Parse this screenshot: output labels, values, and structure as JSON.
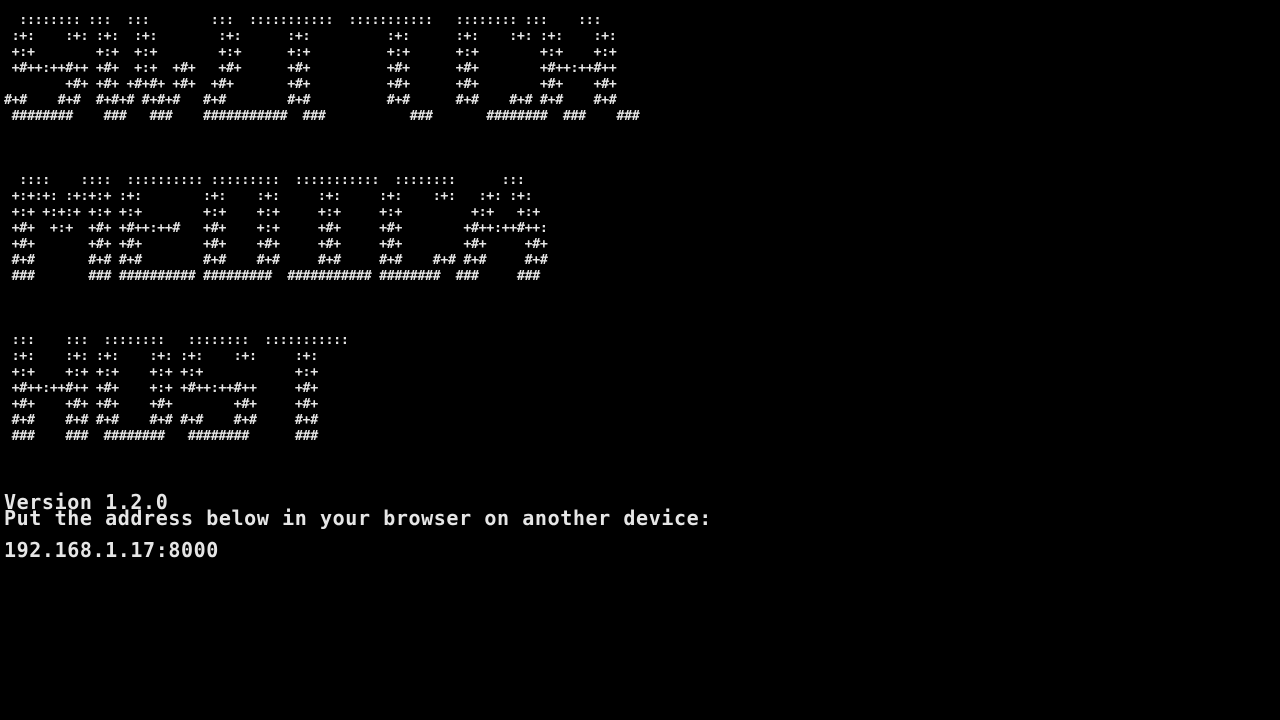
{
  "colors": {
    "background": "#000000",
    "text": "#e6e6e6"
  },
  "banner": {
    "line1": "  :::::::: :::  :::        :::  :::::::::::  :::::::::::   :::::::: :::    :::\n :+:    :+: :+:  :+:        :+:      :+:          :+:      :+:    :+: :+:    :+:\n +:+        +:+  +:+        +:+      +:+          +:+      +:+        +:+    +:+\n +#++:++#++ +#+  +:+  +#+   +#+      +#+          +#+      +#+        +#++:++#++\n        +#+ +#+ +#+#+ +#+  +#+       +#+          +#+      +#+        +#+    +#+\n#+#    #+#  #+#+# #+#+#   #+#        #+#          #+#      #+#    #+# #+#    #+#\n ########    ###   ###    ###########  ###           ###       ########  ###    ###",
    "line2": "  ::::    ::::  :::::::::: :::::::::  :::::::::::  ::::::::      :::\n +:+:+: :+:+:+ :+:        :+:    :+:     :+:     :+:    :+:   :+: :+:\n +:+ +:+:+ +:+ +:+        +:+    +:+     +:+     +:+         +:+   +:+\n +#+  +:+  +#+ +#++:++#   +#+    +:+     +#+     +#+        +#++:++#++:\n +#+       +#+ +#+        +#+    +#+     +#+     +#+        +#+     +#+\n #+#       #+# #+#        #+#    #+#     #+#     #+#    #+# #+#     #+#\n ###       ### ########## #########  ########### ########  ###     ###",
    "line3": " :::    :::  ::::::::   ::::::::  :::::::::::\n :+:    :+: :+:    :+: :+:    :+:     :+:\n +:+    +:+ +:+    +:+ +:+            +:+\n +#++:++#++ +#+    +:+ +#++:++#++     +#+\n +#+    +#+ +#+    +#+        +#+     +#+\n #+#    #+# #+#    #+# #+#    #+#     #+#\n ###    ###  ########   ########      ###"
  },
  "info": {
    "version": "Version 1.2.0",
    "instruction": "Put the address below in your browser on another device:",
    "address": "192.168.1.17:8000"
  }
}
